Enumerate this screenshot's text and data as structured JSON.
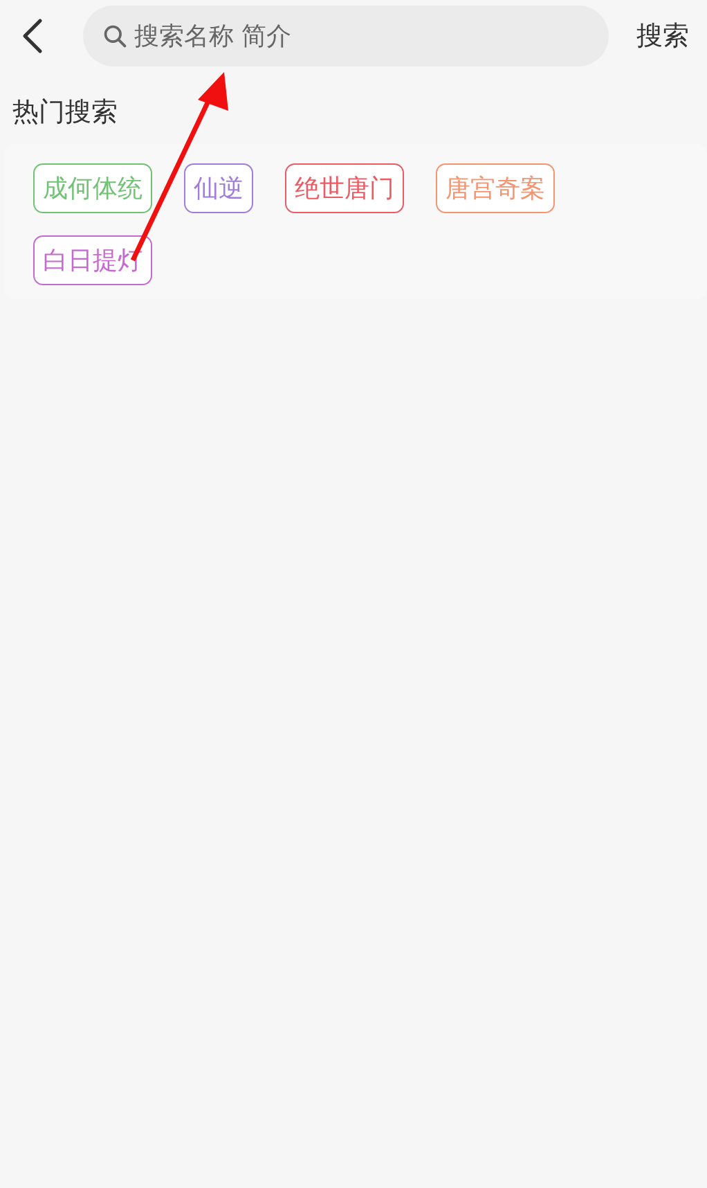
{
  "search": {
    "placeholder": "搜索名称 简介",
    "button": "搜索"
  },
  "hot_search": {
    "title": "热门搜索",
    "tags": [
      {
        "label": "成何体统",
        "color": "#72c276"
      },
      {
        "label": "仙逆",
        "color": "#a07ddc"
      },
      {
        "label": "绝世唐门",
        "color": "#ec5a64"
      },
      {
        "label": "唐宫奇案",
        "color": "#f59470"
      },
      {
        "label": "白日提灯",
        "color": "#c66ad2"
      }
    ]
  }
}
